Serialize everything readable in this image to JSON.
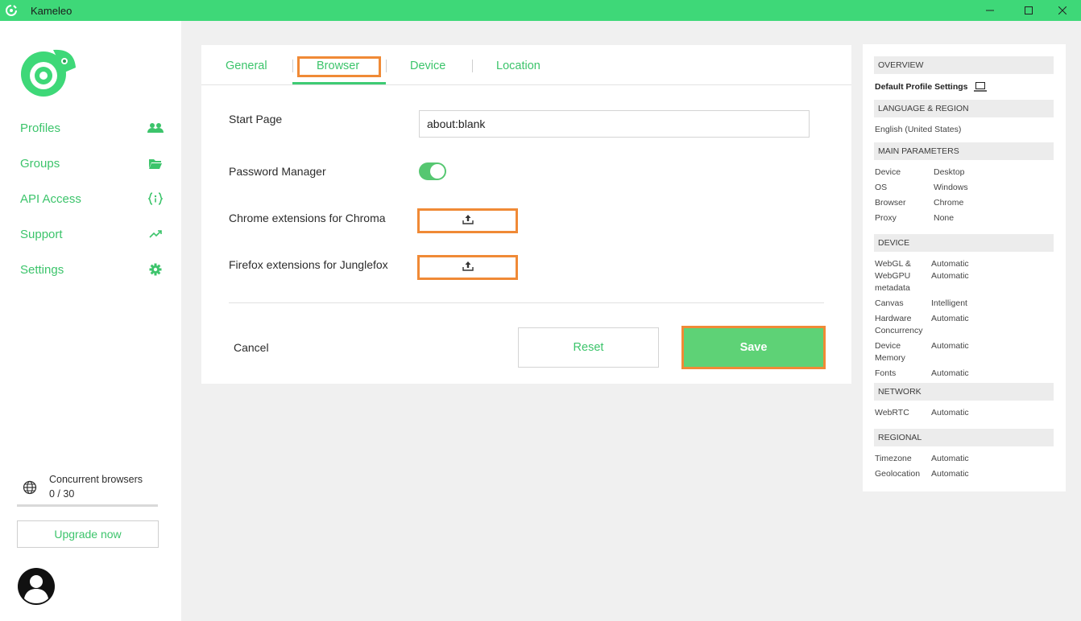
{
  "window": {
    "title": "Kameleo"
  },
  "sidebar": {
    "items": [
      {
        "label": "Profiles",
        "icon": "users-icon"
      },
      {
        "label": "Groups",
        "icon": "folder-open-icon"
      },
      {
        "label": "API Access",
        "icon": "code-braces-icon"
      },
      {
        "label": "Support",
        "icon": "trending-up-icon"
      },
      {
        "label": "Settings",
        "icon": "gear-icon"
      }
    ],
    "concurrent": {
      "title": "Concurrent browsers",
      "count": "0 / 30"
    },
    "upgrade_label": "Upgrade now"
  },
  "tabs": [
    {
      "label": "General"
    },
    {
      "label": "Browser",
      "active": true
    },
    {
      "label": "Device"
    },
    {
      "label": "Location"
    }
  ],
  "form": {
    "start_page": {
      "label": "Start Page",
      "value": "about:blank"
    },
    "password_manager": {
      "label": "Password Manager",
      "enabled": true
    },
    "chrome_ext": {
      "label": "Chrome extensions for Chroma"
    },
    "firefox_ext": {
      "label": "Firefox extensions for Junglefox"
    }
  },
  "actions": {
    "cancel": "Cancel",
    "reset": "Reset",
    "save": "Save"
  },
  "overview": {
    "overview_head": "OVERVIEW",
    "profile_title": "Default Profile Settings",
    "lang_head": "LANGUAGE & REGION",
    "language": "English (United States)",
    "main_head": "MAIN PARAMETERS",
    "main": [
      {
        "k": "Device",
        "v": "Desktop"
      },
      {
        "k": "OS",
        "v": "Windows"
      },
      {
        "k": "Browser",
        "v": "Chrome"
      },
      {
        "k": "Proxy",
        "v": "None"
      }
    ],
    "device_head": "DEVICE",
    "device": {
      "webgl_k1": "WebGL &",
      "webgl_k2": "WebGPU",
      "webgl_k3": "metadata",
      "webgl_v1": "Automatic",
      "webgl_v2": "Automatic",
      "canvas_k": "Canvas",
      "canvas_v": "Intelligent",
      "hw_k1": "Hardware",
      "hw_k2": "Concurrency",
      "hw_v": "Automatic",
      "mem_k1": "Device",
      "mem_k2": "Memory",
      "mem_v": "Automatic",
      "fonts_k": "Fonts",
      "fonts_v": "Automatic"
    },
    "network_head": "NETWORK",
    "webrtc_k": "WebRTC",
    "webrtc_v": "Automatic",
    "regional_head": "REGIONAL",
    "timezone_k": "Timezone",
    "timezone_v": "Automatic",
    "geo_k": "Geolocation",
    "geo_v": "Automatic"
  },
  "colors": {
    "accent": "#3cc46b",
    "titlebar": "#3ed878",
    "highlight": "#f08a36",
    "save_bg": "#5ed276"
  }
}
